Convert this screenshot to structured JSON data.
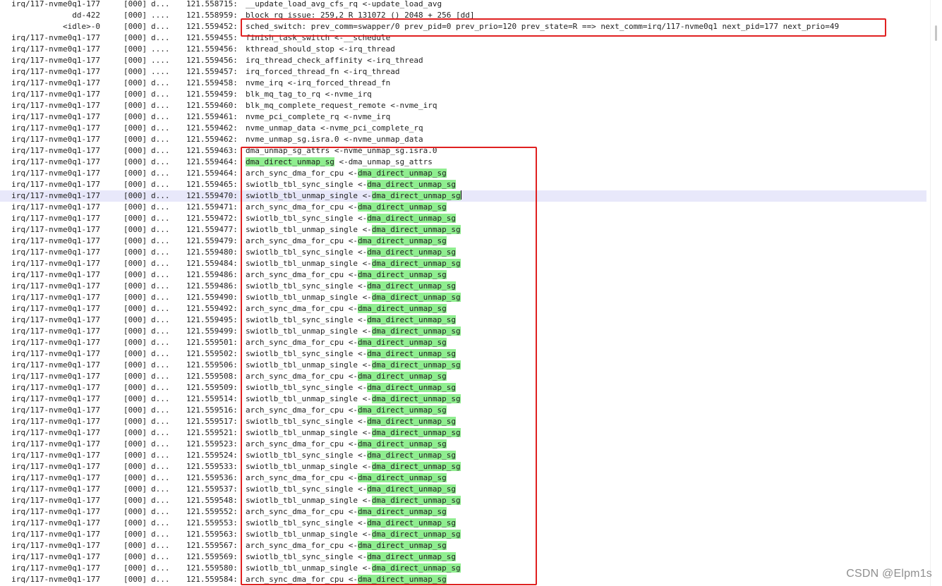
{
  "watermark": "CSDN @Elpm1s",
  "colors": {
    "highlight_text_bg": "#90ee90",
    "selected_row_bg": "#e8e8fa",
    "annotation_border": "#e02020"
  },
  "trace_rows": [
    {
      "task": "irq/117-nvme0q1-177",
      "cpu": "[000]",
      "flags": "d...",
      "ts": "121.558715:",
      "fn": "__update_load_avg_cfs_rq <-update_load_avg"
    },
    {
      "task": "dd-422",
      "cpu": "[000]",
      "flags": "....",
      "ts": "121.558959:",
      "fn": "block_rq_issue: 259,2 R 131072 () 2048 + 256 [dd]"
    },
    {
      "task": "<idle>-0",
      "cpu": "[000]",
      "flags": "d...",
      "ts": "121.559452:",
      "fn": "sched_switch: prev_comm=swapper/0 prev_pid=0 prev_prio=120 prev_state=R ==> next_comm=irq/117-nvme0q1 next_pid=177 next_prio=49"
    },
    {
      "task": "irq/117-nvme0q1-177",
      "cpu": "[000]",
      "flags": "d...",
      "ts": "121.559455:",
      "fn": "finish_task_switch <-__schedule"
    },
    {
      "task": "irq/117-nvme0q1-177",
      "cpu": "[000]",
      "flags": "....",
      "ts": "121.559456:",
      "fn": "kthread_should_stop <-irq_thread"
    },
    {
      "task": "irq/117-nvme0q1-177",
      "cpu": "[000]",
      "flags": "....",
      "ts": "121.559456:",
      "fn": "irq_thread_check_affinity <-irq_thread"
    },
    {
      "task": "irq/117-nvme0q1-177",
      "cpu": "[000]",
      "flags": "....",
      "ts": "121.559457:",
      "fn": "irq_forced_thread_fn <-irq_thread"
    },
    {
      "task": "irq/117-nvme0q1-177",
      "cpu": "[000]",
      "flags": "d...",
      "ts": "121.559458:",
      "fn": "nvme_irq <-irq_forced_thread_fn"
    },
    {
      "task": "irq/117-nvme0q1-177",
      "cpu": "[000]",
      "flags": "d...",
      "ts": "121.559459:",
      "fn": "blk_mq_tag_to_rq <-nvme_irq"
    },
    {
      "task": "irq/117-nvme0q1-177",
      "cpu": "[000]",
      "flags": "d...",
      "ts": "121.559460:",
      "fn": "blk_mq_complete_request_remote <-nvme_irq"
    },
    {
      "task": "irq/117-nvme0q1-177",
      "cpu": "[000]",
      "flags": "d...",
      "ts": "121.559461:",
      "fn": "nvme_pci_complete_rq <-nvme_irq"
    },
    {
      "task": "irq/117-nvme0q1-177",
      "cpu": "[000]",
      "flags": "d...",
      "ts": "121.559462:",
      "fn": "nvme_unmap_data <-nvme_pci_complete_rq"
    },
    {
      "task": "irq/117-nvme0q1-177",
      "cpu": "[000]",
      "flags": "d...",
      "ts": "121.559462:",
      "fn": "nvme_unmap_sg.isra.0 <-nvme_unmap_data"
    },
    {
      "task": "irq/117-nvme0q1-177",
      "cpu": "[000]",
      "flags": "d...",
      "ts": "121.559463:",
      "fn": "dma_unmap_sg_attrs <-nvme_unmap_sg.isra.0"
    },
    {
      "task": "irq/117-nvme0q1-177",
      "cpu": "[000]",
      "flags": "d...",
      "ts": "121.559464:",
      "fn_hl": "dma_direct_unmap_sg",
      "fn_rest": " <-dma_unmap_sg_attrs"
    },
    {
      "task": "irq/117-nvme0q1-177",
      "cpu": "[000]",
      "flags": "d...",
      "ts": "121.559464:",
      "fn": "arch_sync_dma_for_cpu <-",
      "fn_hl": "dma_direct_unmap_sg"
    },
    {
      "task": "irq/117-nvme0q1-177",
      "cpu": "[000]",
      "flags": "d...",
      "ts": "121.559465:",
      "fn": "swiotlb_tbl_sync_single <-",
      "fn_hl": "dma_direct_unmap_sg"
    },
    {
      "task": "irq/117-nvme0q1-177",
      "cpu": "[000]",
      "flags": "d...",
      "ts": "121.559470:",
      "fn": "swiotlb_tbl_unmap_single <-",
      "fn_hl": "dma_direct_unmap_sg",
      "selected": true
    },
    {
      "task": "irq/117-nvme0q1-177",
      "cpu": "[000]",
      "flags": "d...",
      "ts": "121.559471:",
      "fn": "arch_sync_dma_for_cpu <-",
      "fn_hl": "dma_direct_unmap_sg"
    },
    {
      "task": "irq/117-nvme0q1-177",
      "cpu": "[000]",
      "flags": "d...",
      "ts": "121.559472:",
      "fn": "swiotlb_tbl_sync_single <-",
      "fn_hl": "dma_direct_unmap_sg"
    },
    {
      "task": "irq/117-nvme0q1-177",
      "cpu": "[000]",
      "flags": "d...",
      "ts": "121.559477:",
      "fn": "swiotlb_tbl_unmap_single <-",
      "fn_hl": "dma_direct_unmap_sg"
    },
    {
      "task": "irq/117-nvme0q1-177",
      "cpu": "[000]",
      "flags": "d...",
      "ts": "121.559479:",
      "fn": "arch_sync_dma_for_cpu <-",
      "fn_hl": "dma_direct_unmap_sg"
    },
    {
      "task": "irq/117-nvme0q1-177",
      "cpu": "[000]",
      "flags": "d...",
      "ts": "121.559480:",
      "fn": "swiotlb_tbl_sync_single <-",
      "fn_hl": "dma_direct_unmap_sg"
    },
    {
      "task": "irq/117-nvme0q1-177",
      "cpu": "[000]",
      "flags": "d...",
      "ts": "121.559484:",
      "fn": "swiotlb_tbl_unmap_single <-",
      "fn_hl": "dma_direct_unmap_sg"
    },
    {
      "task": "irq/117-nvme0q1-177",
      "cpu": "[000]",
      "flags": "d...",
      "ts": "121.559486:",
      "fn": "arch_sync_dma_for_cpu <-",
      "fn_hl": "dma_direct_unmap_sg"
    },
    {
      "task": "irq/117-nvme0q1-177",
      "cpu": "[000]",
      "flags": "d...",
      "ts": "121.559486:",
      "fn": "swiotlb_tbl_sync_single <-",
      "fn_hl": "dma_direct_unmap_sg"
    },
    {
      "task": "irq/117-nvme0q1-177",
      "cpu": "[000]",
      "flags": "d...",
      "ts": "121.559490:",
      "fn": "swiotlb_tbl_unmap_single <-",
      "fn_hl": "dma_direct_unmap_sg"
    },
    {
      "task": "irq/117-nvme0q1-177",
      "cpu": "[000]",
      "flags": "d...",
      "ts": "121.559492:",
      "fn": "arch_sync_dma_for_cpu <-",
      "fn_hl": "dma_direct_unmap_sg"
    },
    {
      "task": "irq/117-nvme0q1-177",
      "cpu": "[000]",
      "flags": "d...",
      "ts": "121.559495:",
      "fn": "swiotlb_tbl_sync_single <-",
      "fn_hl": "dma_direct_unmap_sg"
    },
    {
      "task": "irq/117-nvme0q1-177",
      "cpu": "[000]",
      "flags": "d...",
      "ts": "121.559499:",
      "fn": "swiotlb_tbl_unmap_single <-",
      "fn_hl": "dma_direct_unmap_sg"
    },
    {
      "task": "irq/117-nvme0q1-177",
      "cpu": "[000]",
      "flags": "d...",
      "ts": "121.559501:",
      "fn": "arch_sync_dma_for_cpu <-",
      "fn_hl": "dma_direct_unmap_sg"
    },
    {
      "task": "irq/117-nvme0q1-177",
      "cpu": "[000]",
      "flags": "d...",
      "ts": "121.559502:",
      "fn": "swiotlb_tbl_sync_single <-",
      "fn_hl": "dma_direct_unmap_sg"
    },
    {
      "task": "irq/117-nvme0q1-177",
      "cpu": "[000]",
      "flags": "d...",
      "ts": "121.559506:",
      "fn": "swiotlb_tbl_unmap_single <-",
      "fn_hl": "dma_direct_unmap_sg"
    },
    {
      "task": "irq/117-nvme0q1-177",
      "cpu": "[000]",
      "flags": "d...",
      "ts": "121.559508:",
      "fn": "arch_sync_dma_for_cpu <-",
      "fn_hl": "dma_direct_unmap_sg"
    },
    {
      "task": "irq/117-nvme0q1-177",
      "cpu": "[000]",
      "flags": "d...",
      "ts": "121.559509:",
      "fn": "swiotlb_tbl_sync_single <-",
      "fn_hl": "dma_direct_unmap_sg"
    },
    {
      "task": "irq/117-nvme0q1-177",
      "cpu": "[000]",
      "flags": "d...",
      "ts": "121.559514:",
      "fn": "swiotlb_tbl_unmap_single <-",
      "fn_hl": "dma_direct_unmap_sg"
    },
    {
      "task": "irq/117-nvme0q1-177",
      "cpu": "[000]",
      "flags": "d...",
      "ts": "121.559516:",
      "fn": "arch_sync_dma_for_cpu <-",
      "fn_hl": "dma_direct_unmap_sg"
    },
    {
      "task": "irq/117-nvme0q1-177",
      "cpu": "[000]",
      "flags": "d...",
      "ts": "121.559517:",
      "fn": "swiotlb_tbl_sync_single <-",
      "fn_hl": "dma_direct_unmap_sg"
    },
    {
      "task": "irq/117-nvme0q1-177",
      "cpu": "[000]",
      "flags": "d...",
      "ts": "121.559521:",
      "fn": "swiotlb_tbl_unmap_single <-",
      "fn_hl": "dma_direct_unmap_sg"
    },
    {
      "task": "irq/117-nvme0q1-177",
      "cpu": "[000]",
      "flags": "d...",
      "ts": "121.559523:",
      "fn": "arch_sync_dma_for_cpu <-",
      "fn_hl": "dma_direct_unmap_sg"
    },
    {
      "task": "irq/117-nvme0q1-177",
      "cpu": "[000]",
      "flags": "d...",
      "ts": "121.559524:",
      "fn": "swiotlb_tbl_sync_single <-",
      "fn_hl": "dma_direct_unmap_sg"
    },
    {
      "task": "irq/117-nvme0q1-177",
      "cpu": "[000]",
      "flags": "d...",
      "ts": "121.559533:",
      "fn": "swiotlb_tbl_unmap_single <-",
      "fn_hl": "dma_direct_unmap_sg"
    },
    {
      "task": "irq/117-nvme0q1-177",
      "cpu": "[000]",
      "flags": "d...",
      "ts": "121.559536:",
      "fn": "arch_sync_dma_for_cpu <-",
      "fn_hl": "dma_direct_unmap_sg"
    },
    {
      "task": "irq/117-nvme0q1-177",
      "cpu": "[000]",
      "flags": "d...",
      "ts": "121.559537:",
      "fn": "swiotlb_tbl_sync_single <-",
      "fn_hl": "dma_direct_unmap_sg"
    },
    {
      "task": "irq/117-nvme0q1-177",
      "cpu": "[000]",
      "flags": "d...",
      "ts": "121.559548:",
      "fn": "swiotlb_tbl_unmap_single <-",
      "fn_hl": "dma_direct_unmap_sg"
    },
    {
      "task": "irq/117-nvme0q1-177",
      "cpu": "[000]",
      "flags": "d...",
      "ts": "121.559552:",
      "fn": "arch_sync_dma_for_cpu <-",
      "fn_hl": "dma_direct_unmap_sg"
    },
    {
      "task": "irq/117-nvme0q1-177",
      "cpu": "[000]",
      "flags": "d...",
      "ts": "121.559553:",
      "fn": "swiotlb_tbl_sync_single <-",
      "fn_hl": "dma_direct_unmap_sg"
    },
    {
      "task": "irq/117-nvme0q1-177",
      "cpu": "[000]",
      "flags": "d...",
      "ts": "121.559563:",
      "fn": "swiotlb_tbl_unmap_single <-",
      "fn_hl": "dma_direct_unmap_sg"
    },
    {
      "task": "irq/117-nvme0q1-177",
      "cpu": "[000]",
      "flags": "d...",
      "ts": "121.559567:",
      "fn": "arch_sync_dma_for_cpu <-",
      "fn_hl": "dma_direct_unmap_sg"
    },
    {
      "task": "irq/117-nvme0q1-177",
      "cpu": "[000]",
      "flags": "d...",
      "ts": "121.559569:",
      "fn": "swiotlb_tbl_sync_single <-",
      "fn_hl": "dma_direct_unmap_sg"
    },
    {
      "task": "irq/117-nvme0q1-177",
      "cpu": "[000]",
      "flags": "d...",
      "ts": "121.559580:",
      "fn": "swiotlb_tbl_unmap_single <-",
      "fn_hl": "dma_direct_unmap_sg"
    },
    {
      "task": "irq/117-nvme0q1-177",
      "cpu": "[000]",
      "flags": "d...",
      "ts": "121.559584:",
      "fn": "arch_sync_dma_for_cpu <-",
      "fn_hl": "dma_direct_unmap_sg"
    }
  ]
}
